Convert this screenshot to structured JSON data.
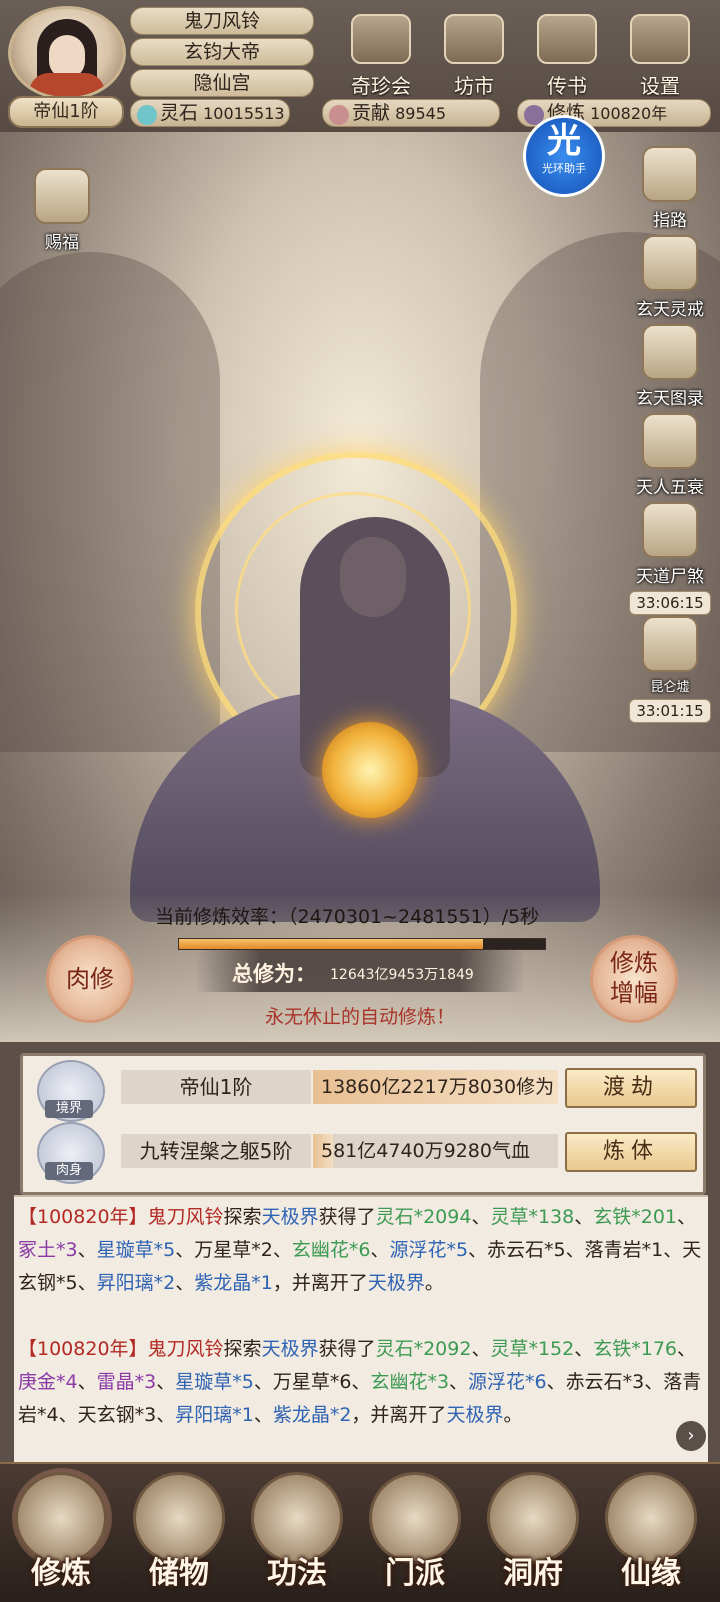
{
  "player": {
    "rank": "帝仙1阶",
    "name": "鬼刀风铃",
    "title": "玄钧大帝",
    "sect": "隐仙宫"
  },
  "resources": [
    {
      "label": "灵石",
      "value": "10015513",
      "icon": "spirit-stone-icon",
      "color": "#6fc5c9"
    },
    {
      "label": "贡献",
      "value": "89545",
      "icon": "contribution-icon",
      "color": "#c98f8f"
    },
    {
      "label": "修炼",
      "value": "100820年",
      "icon": "cultivation-time-icon",
      "color": "#8a6f9a"
    }
  ],
  "top_menu": [
    "奇珍会",
    "坊市",
    "传书",
    "设置"
  ],
  "helper_badge": {
    "big": "光",
    "small": "光环助手"
  },
  "blessing_label": "赐福",
  "side_menu": [
    {
      "label": "指路",
      "icon": "guide-icon"
    },
    {
      "label": "玄天灵戒",
      "icon": "spirit-ring-icon"
    },
    {
      "label": "玄天图录",
      "icon": "scroll-icon"
    },
    {
      "label": "天人五衰",
      "icon": "decay-icon"
    },
    {
      "label": "天道尸煞",
      "icon": "demon-icon",
      "timer": "33:06:15"
    },
    {
      "label": "昆仑墟",
      "icon": "kunlun-icon",
      "timer": "33:01:15"
    }
  ],
  "cultivation": {
    "efficiency_label": "当前修炼效率：（2470301~2481551）/5秒",
    "efficiency_progress": 0.83,
    "total_label": "总修为：",
    "total_value": "12643亿9453万1849",
    "auto_text": "永无休止的自动修炼！",
    "left_button": "肉修",
    "right_button_line1": "修炼",
    "right_button_line2": "增幅"
  },
  "panel_rows": [
    {
      "tag": "境界",
      "name": "帝仙1阶",
      "value": "13860亿2217万8030修为",
      "progress": 1.0,
      "button": "渡劫"
    },
    {
      "tag": "肉身",
      "name": "九转涅槃之躯5阶",
      "value": "581亿4740万9280气血",
      "progress": 0.08,
      "button": "炼体"
    }
  ],
  "log": [
    {
      "year": "【100820年】",
      "name": "鬼刀风铃",
      "verb": "探索",
      "place": "天极界",
      "got": "获得了",
      "items": [
        {
          "text": "灵石*2094",
          "color": "green"
        },
        {
          "text": "灵草*138",
          "color": "green"
        },
        {
          "text": "玄铁*201",
          "color": "green"
        },
        {
          "text": "冢土*3",
          "color": "purple"
        },
        {
          "text": "星璇草*5",
          "color": "place"
        },
        {
          "text": "万星草*2",
          "color": "plain"
        },
        {
          "text": "玄幽花*6",
          "color": "green"
        },
        {
          "text": "源浮花*5",
          "color": "place"
        },
        {
          "text": "赤云石*5",
          "color": "plain"
        },
        {
          "text": "落青岩*1",
          "color": "plain"
        },
        {
          "text": "天玄钢*5",
          "color": "plain"
        },
        {
          "text": "昇阳璃*2",
          "color": "place"
        },
        {
          "text": "紫龙晶*1",
          "color": "place"
        }
      ],
      "leave": "，并离开了",
      "place_end": "天极界",
      "end": "。"
    },
    {
      "year": "【100820年】",
      "name": "鬼刀风铃",
      "verb": "探索",
      "place": "天极界",
      "got": "获得了",
      "items": [
        {
          "text": "灵石*2092",
          "color": "green"
        },
        {
          "text": "灵草*152",
          "color": "green"
        },
        {
          "text": "玄铁*176",
          "color": "green"
        },
        {
          "text": "庚金*4",
          "color": "purple"
        },
        {
          "text": "雷晶*3",
          "color": "purple"
        },
        {
          "text": "星璇草*5",
          "color": "place"
        },
        {
          "text": "万星草*6",
          "color": "plain"
        },
        {
          "text": "玄幽花*3",
          "color": "green"
        },
        {
          "text": "源浮花*6",
          "color": "place"
        },
        {
          "text": "赤云石*3",
          "color": "plain"
        },
        {
          "text": "落青岩*4",
          "color": "plain"
        },
        {
          "text": "天玄钢*3",
          "color": "plain"
        },
        {
          "text": "昇阳璃*1",
          "color": "place"
        },
        {
          "text": "紫龙晶*2",
          "color": "place"
        }
      ],
      "leave": "，并离开了",
      "place_end": "天极界",
      "end": "。"
    }
  ],
  "bottom_nav": [
    {
      "label": "修炼",
      "active": true
    },
    {
      "label": "储物",
      "active": false
    },
    {
      "label": "功法",
      "active": false
    },
    {
      "label": "门派",
      "active": false
    },
    {
      "label": "洞府",
      "active": false
    },
    {
      "label": "仙缘",
      "active": false
    }
  ]
}
